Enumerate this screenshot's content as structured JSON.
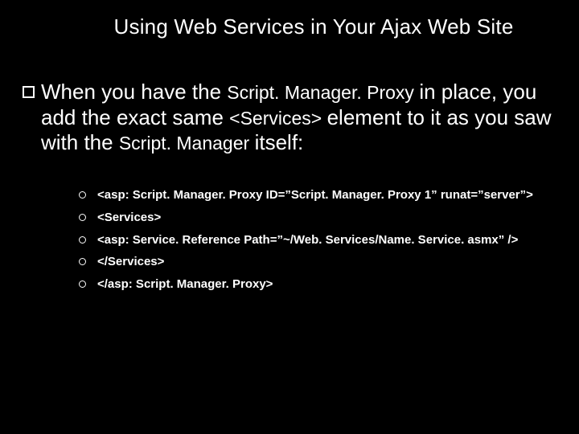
{
  "slide": {
    "title": "Using Web Services in Your Ajax Web Site",
    "paragraph": {
      "pre1": "When you have the ",
      "mono1": "Script. Manager. Proxy ",
      "mid1": "in place, you add the exact same ",
      "mono2": "<Services> ",
      "mid2": "element to it as you saw with the ",
      "mono3": "Script. Manager ",
      "post": "itself:"
    },
    "code": [
      "<asp: Script. Manager. Proxy ID=”Script. Manager. Proxy 1” runat=”server”>",
      "<Services>",
      "<asp: Service. Reference Path=”~/Web. Services/Name. Service. asmx” />",
      "</Services>",
      "</asp: Script. Manager. Proxy>"
    ]
  }
}
